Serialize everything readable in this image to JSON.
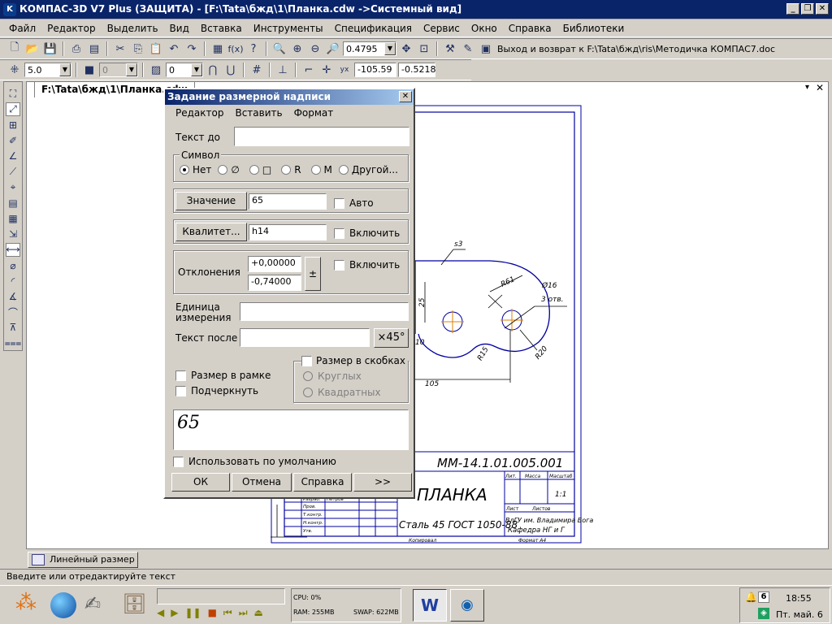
{
  "window": {
    "title": "КОМПАС-3D V7 Plus (ЗАЩИТА) - [F:\\Tata\\бжд\\1\\Планка.cdw ->Системный вид]"
  },
  "menu": [
    "Файл",
    "Редактор",
    "Выделить",
    "Вид",
    "Вставка",
    "Инструменты",
    "Спецификация",
    "Сервис",
    "Окно",
    "Справка",
    "Библиотеки"
  ],
  "toolbar1": {
    "zoom_value": "0.4795",
    "link_text": "Выход и возврат к F:\\Tata\\бжд\\ris\\Методичка КОМПАС7.doc"
  },
  "toolbar2": {
    "step_value": "5.0",
    "layer_value": "0",
    "style_value": "0",
    "coord_x": "-105.59",
    "coord_y": "-0.5218"
  },
  "doc_tab": "F:\\Tata\\бжд\\1\\Планка.cdw",
  "dialog": {
    "title": "Задание размерной надписи",
    "menu": [
      "Редактор",
      "Вставить",
      "Формат"
    ],
    "text_before_label": "Текст до",
    "text_before_value": "",
    "symbol_group": "Символ",
    "symbols": [
      "Нет",
      "∅",
      "□",
      "R",
      "M",
      "Другой..."
    ],
    "value_button": "Значение",
    "value": "65",
    "auto_label": "Авто",
    "qualitet_button": "Квалитет...",
    "qualitet_value": "h14",
    "qualitet_include": "Включить",
    "deviations_label": "Отклонения",
    "dev_upper": "+0,00000",
    "dev_lower": "-0,74000",
    "pm_button": "±",
    "deviations_include": "Включить",
    "unit_label_1": "Единица",
    "unit_label_2": "измерения",
    "unit_value": "",
    "text_after_label": "Текст после",
    "text_after_value": "",
    "x45_button": "×45°",
    "brackets_label": "Размер в скобках",
    "round_label": "Круглых",
    "square_label": "Квадратных",
    "frame_label": "Размер в рамке",
    "underline_label": "Подчеркнуть",
    "preview": "65",
    "default_label": "Использовать по умолчанию",
    "ok": "ОК",
    "cancel": "Отмена",
    "help": "Справка",
    "more": ">>"
  },
  "drawing": {
    "s3": "s3",
    "r61": "R61",
    "dia16": "Ø16",
    "holes": "3 отв.",
    "d25": "25",
    "d10": "10",
    "r15": "R15",
    "r20": "R20",
    "d105": "105",
    "code": "ММ-14.1.01.005.001",
    "part_name": "ПЛАНКА",
    "material": "Сталь 45 ГОСТ 1050-88",
    "org1": "ВлГУ им. Владимира Бога",
    "org2": "Кафедра НГ и Г",
    "sheet_lbl": "Лит.",
    "mass_lbl": "Масса",
    "scale_lbl": "Масштаб",
    "scale_val": "1:1",
    "list_lbl": "Лист",
    "lists_lbl": "Листов",
    "copied": "Копировал",
    "format": "Формат А4",
    "razrab": "Разраб.",
    "petrov": "Петров",
    "prov": "Пров.",
    "tkontr": "Т.контр.",
    "nkontr": "Н.контр.",
    "utv": "Утв."
  },
  "bottom_panel_button": "Линейный размер",
  "status_text": "Введите или отредактируйте текст",
  "taskbar": {
    "cpu": "CPU: 0%",
    "ram": "RAM: 255MB",
    "swap": "SWAP: 622MB",
    "badge": "6",
    "time": "18:55",
    "date": "Пт. май. 6"
  }
}
